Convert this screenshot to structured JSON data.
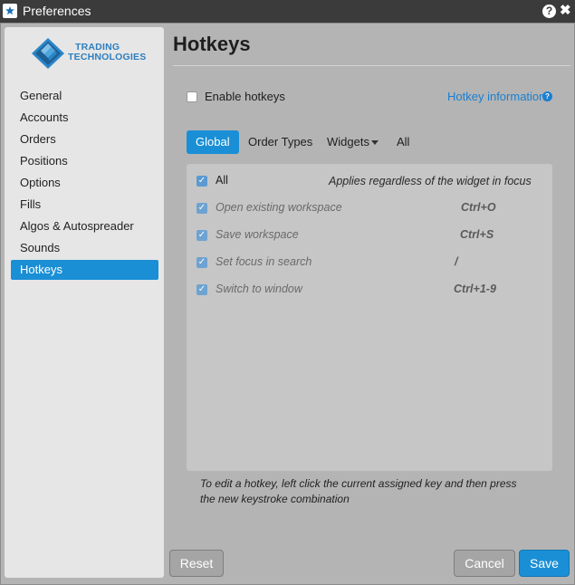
{
  "window": {
    "title": "Preferences",
    "help_glyph": "?",
    "close_glyph": "✖"
  },
  "logo": {
    "line1": "TRADING",
    "line2": "TECHNOLOGIES"
  },
  "sidebar": {
    "items": [
      {
        "label": "General",
        "active": false
      },
      {
        "label": "Accounts",
        "active": false
      },
      {
        "label": "Orders",
        "active": false
      },
      {
        "label": "Positions",
        "active": false
      },
      {
        "label": "Options",
        "active": false
      },
      {
        "label": "Fills",
        "active": false
      },
      {
        "label": "Algos & Autospreader",
        "active": false
      },
      {
        "label": "Sounds",
        "active": false
      },
      {
        "label": "Hotkeys",
        "active": true
      }
    ]
  },
  "main": {
    "title": "Hotkeys",
    "enable_label": "Enable hotkeys",
    "enable_checked": false,
    "info_link": "Hotkey information",
    "info_glyph": "?",
    "tabs": [
      {
        "label": "Global",
        "active": true
      },
      {
        "label": "Order Types",
        "active": false
      },
      {
        "label": "Widgets",
        "active": false,
        "dropdown": true
      },
      {
        "label": "All",
        "active": false
      }
    ],
    "rows": [
      {
        "label": "All",
        "key": "",
        "checked": true
      },
      {
        "label": "Open existing workspace",
        "key": "Ctrl+O",
        "checked": true
      },
      {
        "label": "Save workspace",
        "key": "Ctrl+S",
        "checked": true
      },
      {
        "label": "Set focus in search",
        "key": "/",
        "checked": true
      },
      {
        "label": "Switch to window",
        "key": "Ctrl+1-9",
        "checked": true
      }
    ],
    "applies_text": "Applies regardless of the widget in focus",
    "instructions_line1": "To edit a hotkey, left click the current assigned key and then press",
    "instructions_line2": "the new keystroke combination"
  },
  "buttons": {
    "reset": "Reset",
    "cancel": "Cancel",
    "save": "Save"
  },
  "colors": {
    "accent": "#1a8fd5",
    "titlebar": "#3b3b3b",
    "link": "#1a7fd0"
  }
}
